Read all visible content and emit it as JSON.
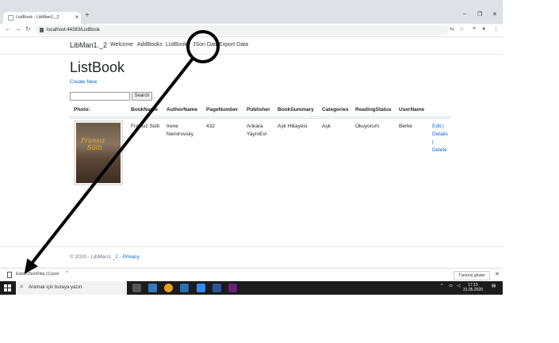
{
  "browser": {
    "tab_title": "ListBook - LibMan1._2",
    "tab_close": "✕",
    "new_tab": "+",
    "url": "localhost:44383/ListBook",
    "minimize": "–",
    "maximize": "❐",
    "close": "✕"
  },
  "site": {
    "brand": "LibMan1._2",
    "nav": [
      "Welcome",
      "AddBooks",
      "ListBook",
      "JSon Data",
      "Export Data"
    ],
    "page_title": "ListBook",
    "create_new": "Create New",
    "search_value": "",
    "search_button": "Search",
    "table": {
      "headers": [
        "Photo:",
        "BookName",
        "AuthorName",
        "PageNumber",
        "Publisher",
        "BookSummary",
        "Categories",
        "ReadingStatus",
        "UserName"
      ],
      "row": {
        "cover_title_1": "Fransız",
        "cover_title_2": "Süiti",
        "book_name": "Fransız Süiti",
        "author_line1": "Irene",
        "author_line2": "Nemirovsky",
        "page_number": "432",
        "publisher_line1": "Ankara",
        "publisher_line2": "YayınEvi",
        "summary": "Aşk Hikayesi",
        "category": "Aşk",
        "reading_status": "Okuyorum",
        "user_name": "Berke",
        "edit": "Edit",
        "sep1": "|",
        "details": "Details",
        "sep2": "|",
        "delete": "Delete"
      }
    },
    "footer_text": "© 2020 - LibMan1._2 - ",
    "footer_privacy": "Privacy"
  },
  "download": {
    "file_name": "ExportJSonData (1).json",
    "chevron": "^",
    "show_all": "Tümünü göster",
    "close": "✕"
  },
  "taskbar": {
    "search_placeholder": "Aramak için buraya yazın",
    "time": "17:15",
    "date": "31.05.2020"
  },
  "colors": {
    "link": "#0366d6",
    "taskbar": "#1c1c1c",
    "annotation": "#000000"
  }
}
